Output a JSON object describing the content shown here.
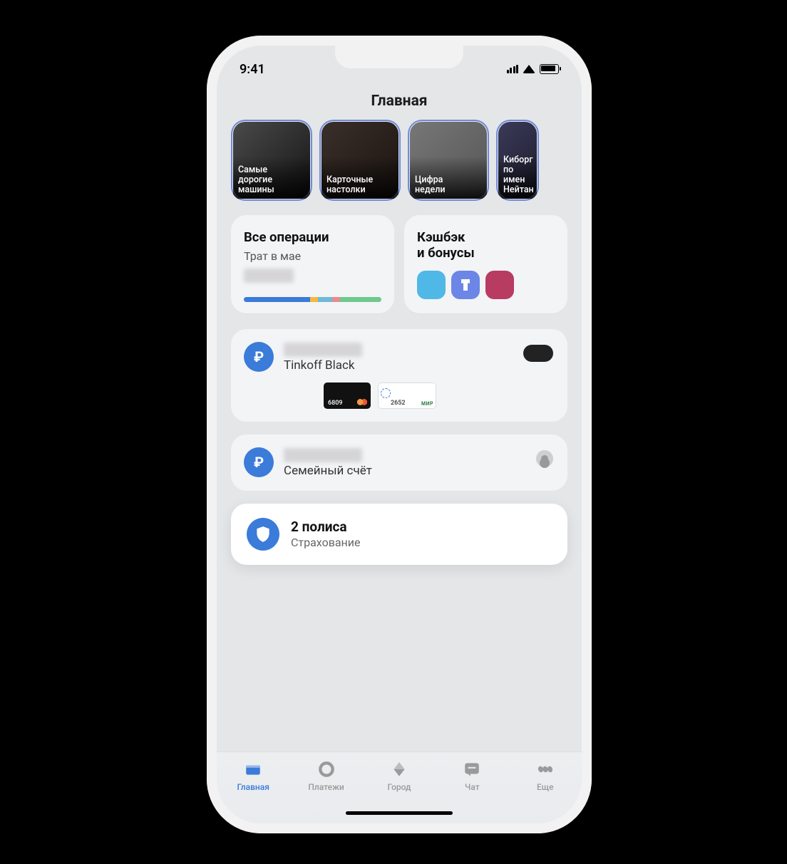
{
  "status": {
    "time": "9:41"
  },
  "header": {
    "title": "Главная"
  },
  "stories": [
    {
      "label": "Самые\nдорогие\nмашины"
    },
    {
      "label": "Карточные\nнастолки"
    },
    {
      "label": "Цифра\nнедели"
    },
    {
      "label": "Киборг\nпо имен\nНейтан"
    }
  ],
  "widgets": {
    "ops": {
      "title": "Все операции",
      "sub": "Трат в мае"
    },
    "cashback": {
      "title": "Кэшбэк\nи бонусы"
    }
  },
  "accounts": [
    {
      "title": "Tinkoff Black",
      "cards": [
        {
          "last4": "6809"
        },
        {
          "last4": "2652",
          "system": "МИР"
        }
      ]
    },
    {
      "title": "Семейный счёт"
    }
  ],
  "insurance": {
    "title": "2 полиса",
    "sub": "Страхование"
  },
  "tabs": [
    {
      "label": "Главная"
    },
    {
      "label": "Платежи"
    },
    {
      "label": "Город"
    },
    {
      "label": "Чат"
    },
    {
      "label": "Еще"
    }
  ]
}
